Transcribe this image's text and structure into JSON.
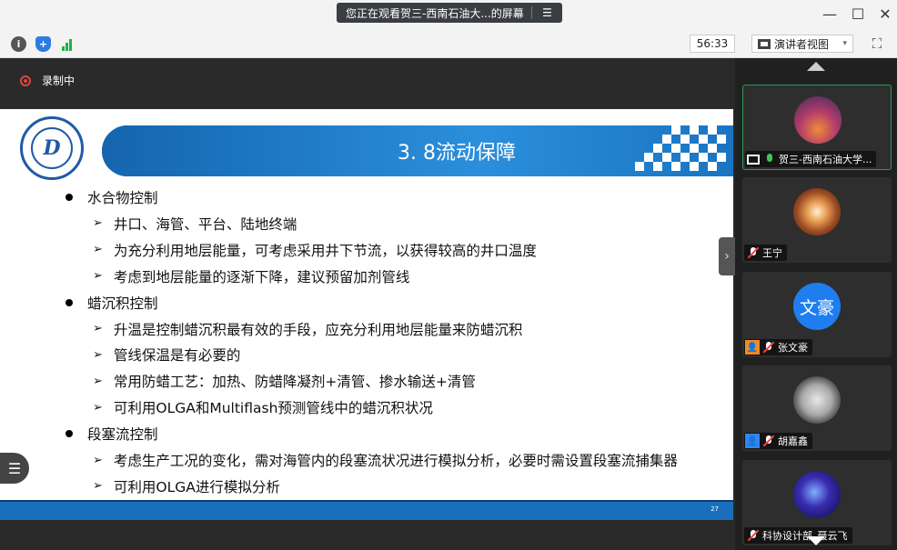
{
  "titlebar": {
    "share_text": "您正在观看贺三-西南石油大...的屏幕",
    "share_menu_icon": "list-icon",
    "minimize_icon": "minimize-icon",
    "maximize_icon": "maximize-icon",
    "close_icon": "close-icon"
  },
  "toolbar": {
    "timer": "56:33",
    "view_label": "演讲者视图",
    "view_caret": "▾"
  },
  "main": {
    "recording_label": "录制中"
  },
  "slide": {
    "title": "3. 8流动保障",
    "page_number": "27",
    "items": [
      {
        "level": 1,
        "text": "水合物控制"
      },
      {
        "level": 2,
        "text": "井口、海管、平台、陆地终端"
      },
      {
        "level": 2,
        "text": "为充分利用地层能量，可考虑采用井下节流，以获得较高的井口温度"
      },
      {
        "level": 2,
        "text": "考虑到地层能量的逐渐下降，建议预留加剂管线"
      },
      {
        "level": 1,
        "text": "蜡沉积控制"
      },
      {
        "level": 2,
        "text": "升温是控制蜡沉积最有效的手段，应充分利用地层能量来防蜡沉积"
      },
      {
        "level": 2,
        "text": "管线保温是有必要的"
      },
      {
        "level": 2,
        "text": "常用防蜡工艺：加热、防蜡降凝剂+清管、掺水输送+清管"
      },
      {
        "level": 2,
        "text": "可利用OLGA和Multiflash预测管线中的蜡沉积状况"
      },
      {
        "level": 1,
        "text": "段塞流控制"
      },
      {
        "level": 2,
        "text": "考虑生产工况的变化，需对海管内的段塞流状况进行模拟分析，必要时需设置段塞流捕集器"
      },
      {
        "level": 2,
        "text": "可利用OLGA进行模拟分析"
      }
    ]
  },
  "participants": [
    {
      "name": "贺三-西南石油大学...",
      "mic": "on",
      "sharing": true,
      "badge": null
    },
    {
      "name": "王宁",
      "mic": "muted",
      "sharing": false,
      "badge": null
    },
    {
      "name": "张文豪",
      "mic": "muted",
      "sharing": false,
      "badge": "orange",
      "avatar_text": "文豪"
    },
    {
      "name": "胡嘉鑫",
      "mic": "muted",
      "sharing": false,
      "badge": "blue"
    },
    {
      "name": "科协设计部_聂云飞",
      "mic": "muted",
      "sharing": false,
      "badge": null
    }
  ],
  "colors": {
    "slide_band": "#1a74c1",
    "recording": "#e04545",
    "active_tile": "#2c9a5a",
    "avatar_blue": "#1e7ef0"
  }
}
